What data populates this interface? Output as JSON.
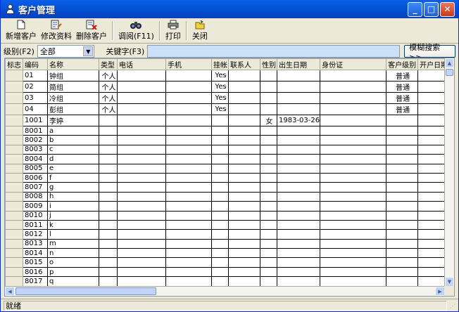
{
  "window": {
    "title": "客户管理",
    "controls": [
      "_",
      "□",
      "✕"
    ]
  },
  "toolbar": {
    "buttons": [
      {
        "label": "新增客户",
        "icon": "new-document-icon"
      },
      {
        "label": "修改资料",
        "icon": "edit-document-icon"
      },
      {
        "label": "删除客户",
        "icon": "delete-document-icon"
      },
      {
        "label": "调阅(F11)",
        "icon": "binoculars-icon"
      },
      {
        "label": "打印",
        "icon": "printer-icon"
      },
      {
        "label": "关闭",
        "icon": "exit-door-icon"
      }
    ]
  },
  "filter": {
    "level_label": "级别(F2)",
    "level_value": "全部",
    "keyword_label": "关键字(F3)",
    "keyword_value": "",
    "fuzzy_search_label": "模糊搜索>>"
  },
  "table": {
    "columns": [
      "标志",
      "编码",
      "名称",
      "类型",
      "电话",
      "手机",
      "挂帐",
      "联系人",
      "性别",
      "出生日期",
      "身份证",
      "客户级别",
      "开户日期"
    ],
    "rows": [
      [
        "",
        "01",
        "钟组",
        "个人",
        "",
        "",
        "Yes",
        "",
        "",
        "",
        "",
        "普通",
        ""
      ],
      [
        "",
        "02",
        "简组",
        "个人",
        "",
        "",
        "Yes",
        "",
        "",
        "",
        "",
        "普通",
        ""
      ],
      [
        "",
        "03",
        "冷组",
        "个人",
        "",
        "",
        "Yes",
        "",
        "",
        "",
        "",
        "普通",
        ""
      ],
      [
        "",
        "04",
        "彭组",
        "个人",
        "",
        "",
        "Yes",
        "",
        "",
        "",
        "",
        "普通",
        ""
      ],
      [
        "",
        "1001",
        "李婷",
        "",
        "",
        "",
        "",
        "",
        "女",
        "1983-03-26",
        "",
        "",
        ""
      ],
      [
        "",
        "8001",
        "a",
        "",
        "",
        "",
        "",
        "",
        "",
        "",
        "",
        "",
        ""
      ],
      [
        "",
        "8002",
        "b",
        "",
        "",
        "",
        "",
        "",
        "",
        "",
        "",
        "",
        ""
      ],
      [
        "",
        "8003",
        "c",
        "",
        "",
        "",
        "",
        "",
        "",
        "",
        "",
        "",
        ""
      ],
      [
        "",
        "8004",
        "d",
        "",
        "",
        "",
        "",
        "",
        "",
        "",
        "",
        "",
        ""
      ],
      [
        "",
        "8005",
        "e",
        "",
        "",
        "",
        "",
        "",
        "",
        "",
        "",
        "",
        ""
      ],
      [
        "",
        "8006",
        "f",
        "",
        "",
        "",
        "",
        "",
        "",
        "",
        "",
        "",
        ""
      ],
      [
        "",
        "8007",
        "g",
        "",
        "",
        "",
        "",
        "",
        "",
        "",
        "",
        "",
        ""
      ],
      [
        "",
        "8008",
        "h",
        "",
        "",
        "",
        "",
        "",
        "",
        "",
        "",
        "",
        ""
      ],
      [
        "",
        "8009",
        "i",
        "",
        "",
        "",
        "",
        "",
        "",
        "",
        "",
        "",
        ""
      ],
      [
        "",
        "8010",
        "j",
        "",
        "",
        "",
        "",
        "",
        "",
        "",
        "",
        "",
        ""
      ],
      [
        "",
        "8011",
        "k",
        "",
        "",
        "",
        "",
        "",
        "",
        "",
        "",
        "",
        ""
      ],
      [
        "",
        "8012",
        "l",
        "",
        "",
        "",
        "",
        "",
        "",
        "",
        "",
        "",
        ""
      ],
      [
        "",
        "8013",
        "m",
        "",
        "",
        "",
        "",
        "",
        "",
        "",
        "",
        "",
        ""
      ],
      [
        "",
        "8014",
        "n",
        "",
        "",
        "",
        "",
        "",
        "",
        "",
        "",
        "",
        ""
      ],
      [
        "",
        "8015",
        "o",
        "",
        "",
        "",
        "",
        "",
        "",
        "",
        "",
        "",
        ""
      ],
      [
        "",
        "8016",
        "p",
        "",
        "",
        "",
        "",
        "",
        "",
        "",
        "",
        "",
        ""
      ],
      [
        "",
        "8017",
        "q",
        "",
        "",
        "",
        "",
        "",
        "",
        "",
        "",
        "",
        ""
      ]
    ]
  },
  "status": {
    "text": "就绪"
  },
  "colors": {
    "titlebar": "#0454D8",
    "keyword_input_bg": "#CCE0F8",
    "window_bg": "#ECE9D8"
  }
}
